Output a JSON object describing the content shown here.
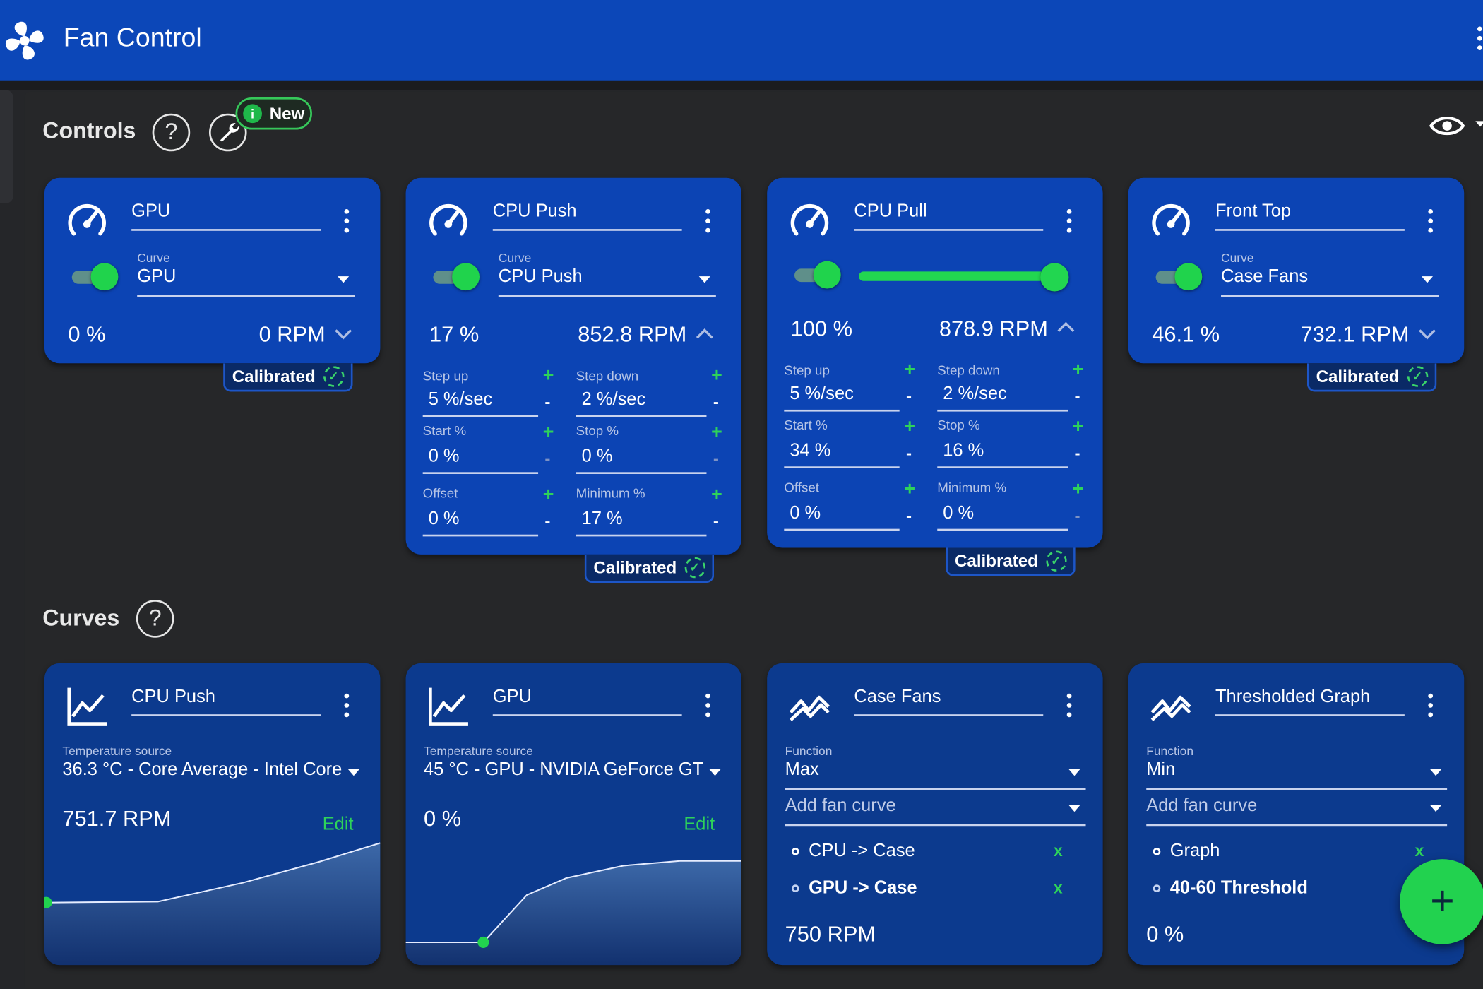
{
  "app": {
    "title": "Fan Control"
  },
  "controls_section": {
    "title": "Controls",
    "help": "?",
    "badge": "New",
    "badge_icon": "i"
  },
  "curves_section": {
    "title": "Curves",
    "help": "?"
  },
  "controls": [
    {
      "name": "GPU",
      "enabled": true,
      "curve_label": "Curve",
      "curve": "GPU",
      "percent": "0 %",
      "rpm": "0 RPM",
      "calibrated": "Calibrated",
      "expanded": false
    },
    {
      "name": "CPU Push",
      "enabled": true,
      "curve_label": "Curve",
      "curve": "CPU Push",
      "percent": "17 %",
      "rpm": "852.8 RPM",
      "calibrated": "Calibrated",
      "expanded": true,
      "params": {
        "step_up_label": "Step up",
        "step_up": "5 %/sec",
        "step_down_label": "Step down",
        "step_down": "2 %/sec",
        "start_label": "Start %",
        "start": "0 %",
        "stop_label": "Stop %",
        "stop": "0 %",
        "offset_label": "Offset",
        "offset": "0 %",
        "minimum_label": "Minimum %",
        "minimum": "17 %"
      }
    },
    {
      "name": "CPU Pull",
      "enabled": true,
      "manual_percent": 100,
      "percent": "100 %",
      "rpm": "878.9 RPM",
      "calibrated": "Calibrated",
      "expanded": true,
      "params": {
        "step_up_label": "Step up",
        "step_up": "5 %/sec",
        "step_down_label": "Step down",
        "step_down": "2 %/sec",
        "start_label": "Start %",
        "start": "34 %",
        "stop_label": "Stop %",
        "stop": "16 %",
        "offset_label": "Offset",
        "offset": "0 %",
        "minimum_label": "Minimum %",
        "minimum": "0 %"
      }
    },
    {
      "name": "Front Top",
      "enabled": true,
      "curve_label": "Curve",
      "curve": "Case Fans",
      "percent": "46.1 %",
      "rpm": "732.1 RPM",
      "calibrated": "Calibrated",
      "expanded": false
    }
  ],
  "curves": [
    {
      "name": "CPU Push",
      "type": "graph",
      "source_label": "Temperature source",
      "source": "36.3 °C - Core Average - Intel Core",
      "value": "751.7 RPM",
      "edit": "Edit"
    },
    {
      "name": "GPU",
      "type": "graph",
      "source_label": "Temperature source",
      "source": "45 °C - GPU - NVIDIA GeForce GT",
      "value": "0 %",
      "edit": "Edit"
    },
    {
      "name": "Case Fans",
      "type": "mix",
      "function_label": "Function",
      "function": "Max",
      "add_placeholder": "Add fan curve",
      "items": [
        {
          "label": "CPU -> Case",
          "active": false
        },
        {
          "label": "GPU -> Case",
          "active": true
        }
      ],
      "remove": "x",
      "value": "750 RPM"
    },
    {
      "name": "Thresholded Graph",
      "type": "mix",
      "function_label": "Function",
      "function": "Min",
      "add_placeholder": "Add fan curve",
      "items": [
        {
          "label": "Graph",
          "active": false
        },
        {
          "label": "40-60 Threshold",
          "active": true
        }
      ],
      "remove": "x",
      "value": "0 %"
    }
  ],
  "fab": {
    "label": "+"
  },
  "icons": {
    "app": "fan-icon",
    "help": "help-icon",
    "tools": "wrench-icon",
    "visibility": "eye-icon",
    "control": "speedometer-icon",
    "graph_curve": "line-chart-icon",
    "mix_curve": "mix-curve-icon",
    "more": "kebab-menu-icon",
    "calibrated": "check-circle-icon",
    "add": "plus-icon"
  },
  "colors": {
    "header": "#0c47b8",
    "card": "#0c44b4",
    "curve_card": "#0c3a8e",
    "accent": "#22d24f",
    "background": "#252629"
  }
}
